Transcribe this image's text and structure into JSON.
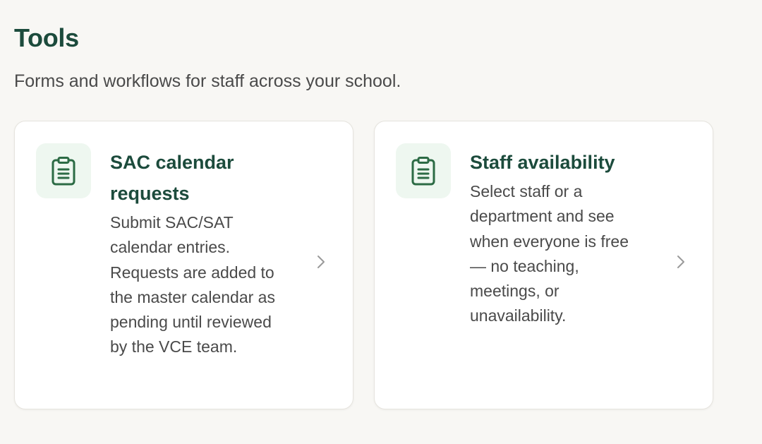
{
  "header": {
    "title": "Tools",
    "subtitle": "Forms and workflows for staff across your school."
  },
  "cards": [
    {
      "title": "SAC calendar requests",
      "description": "Submit SAC/SAT calendar entries. Requests are added to the master calendar as pending until reviewed by the VCE team.",
      "icon": "clipboard-icon"
    },
    {
      "title": "Staff availability",
      "description": "Select staff or a department and see when everyone is free — no teaching, meetings, or unavailability.",
      "icon": "clipboard-icon"
    }
  ],
  "colors": {
    "background": "#f8f7f4",
    "accent": "#1c4b3c",
    "icon_tile": "#eef7f0",
    "icon_stroke": "#2c6b45",
    "text": "#4a4a4a",
    "chevron": "#9a9a9a"
  }
}
